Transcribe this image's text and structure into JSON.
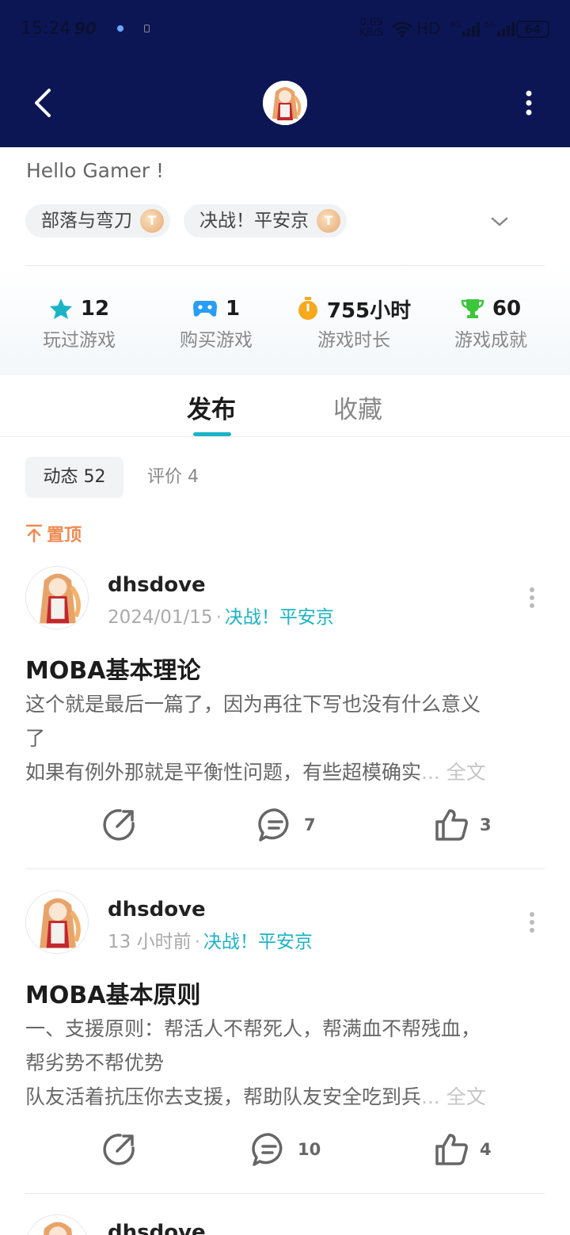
{
  "status_bar": {
    "time": "15:24",
    "network": "90",
    "speed_top": "0.69",
    "speed_bottom": "KB/S",
    "hd": "HD",
    "sig1": "4G",
    "sig2": "5G",
    "battery": "64"
  },
  "header": {
    "icons": {
      "back": "chevron-left-icon",
      "more": "vertical-dots-icon"
    },
    "background": "#0d1654"
  },
  "profile": {
    "greeting": "Hello Gamer !",
    "tags": [
      {
        "label": "部落与弯刀",
        "badge": "T"
      },
      {
        "label": "决战！平安京",
        "badge": "T"
      }
    ]
  },
  "stats": [
    {
      "value": "12",
      "label": "玩过游戏",
      "icon": "star-icon",
      "color": "#1bb3c6"
    },
    {
      "value": "1",
      "label": "购买游戏",
      "icon": "gamepad-icon",
      "color": "#2a9df4"
    },
    {
      "value": "755小时",
      "label": "游戏时长",
      "icon": "stopwatch-icon",
      "color": "#f7a91c"
    },
    {
      "value": "60",
      "label": "游戏成就",
      "icon": "trophy-icon",
      "color": "#3cc63c"
    }
  ],
  "tabs": {
    "active": "发布",
    "inactive": "收藏"
  },
  "filters": {
    "active": "动态 52",
    "inactive": "评价 4"
  },
  "pinned_label": "置顶",
  "posts": [
    {
      "author": "dhsdove",
      "time": "2024/01/15",
      "game": "决战！平安京",
      "title": "MOBA基本理论",
      "lines": [
        "这个就是最后一篇了，因为再往下写也没有什么意义",
        "了",
        "如果有例外那就是平衡性问题，有些超模确实"
      ],
      "read_more": "... 全文",
      "comments": "7",
      "likes": "3"
    },
    {
      "author": "dhsdove",
      "time": "13 小时前",
      "game": "决战！平安京",
      "title": "MOBA基本原则",
      "lines": [
        "一、支援原则：帮活人不帮死人，帮满血不帮残血，",
        "帮劣势不帮优势",
        "队友活着抗压你去支援，帮助队友安全吃到兵"
      ],
      "read_more": "... 全文",
      "comments": "10",
      "likes": "4"
    },
    {
      "author": "dhsdove"
    }
  ],
  "colors": {
    "accent": "#1bb3c6",
    "pin": "#f08a52"
  }
}
